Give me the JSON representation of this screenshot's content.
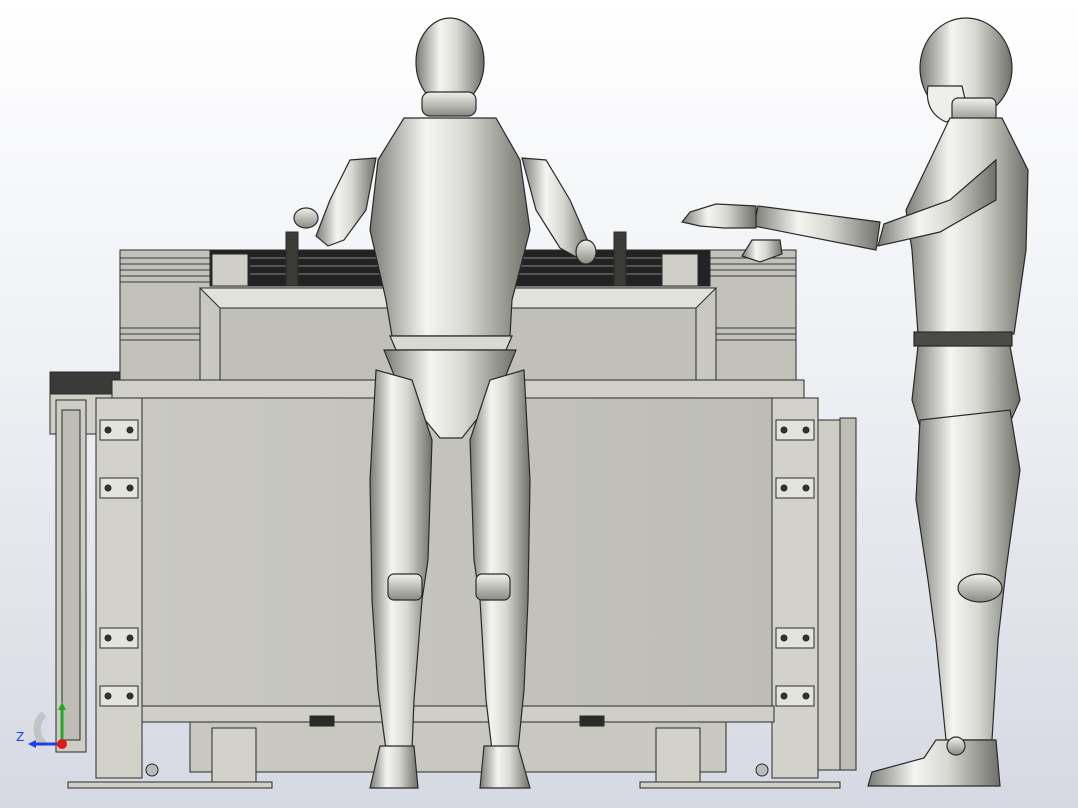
{
  "viewport": {
    "content": "cad-assembly-render"
  },
  "triad": {
    "axis_label": "Z",
    "colors": {
      "z": "#1f3fe0",
      "y": "#22a822",
      "origin": "#e01818"
    }
  },
  "palette": {
    "metal_dark": "#6f6f6a",
    "metal_light": "#f2f2ef",
    "panel": "#c4c4bd",
    "outline": "#2a2a28"
  }
}
